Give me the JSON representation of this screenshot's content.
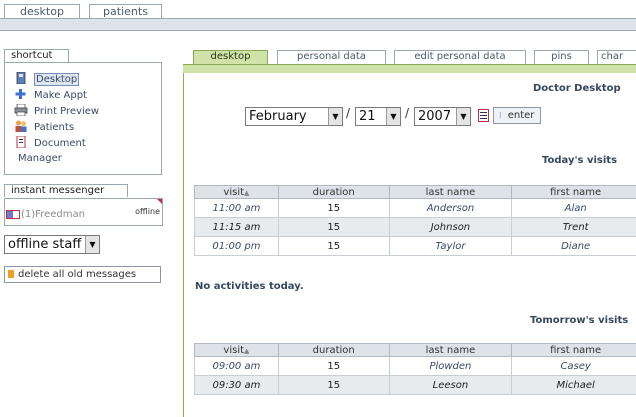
{
  "top_tabs": [
    "desktop",
    "patients"
  ],
  "shortcut": {
    "title": "shortcut",
    "items": [
      "Desktop",
      "Make Appt",
      "Print Preview",
      "Patients",
      "Document",
      "Manager"
    ]
  },
  "messenger": {
    "title": "instant messenger",
    "contact": "(1)Freedman",
    "status": "offline",
    "staff_select": "offline staff",
    "delete_label": "delete all old messages"
  },
  "content_tabs": [
    "desktop",
    "personal data",
    "edit personal data",
    "pins",
    "char"
  ],
  "page_title": "Doctor Desktop",
  "date": {
    "month": "February",
    "day": "21",
    "year": "2007",
    "enter_label": "enter"
  },
  "today": {
    "heading": "Today's visits",
    "headers": [
      "visit",
      "duration",
      "last name",
      "first name"
    ],
    "rows": [
      [
        "11:00 am",
        "15",
        "Anderson",
        "Alan"
      ],
      [
        "11:15 am",
        "15",
        "Johnson",
        "Trent"
      ],
      [
        "01:00 pm",
        "15",
        "Taylor",
        "Diane"
      ]
    ]
  },
  "no_activities": "No activities today.",
  "tomorrow": {
    "heading": "Tomorrow's visits",
    "headers": [
      "visit",
      "duration",
      "last name",
      "first name"
    ],
    "rows": [
      [
        "09:00 am",
        "15",
        "Plowden",
        "Casey"
      ],
      [
        "09:30 am",
        "15",
        "Leeson",
        "Michael"
      ]
    ]
  },
  "colors": {
    "accent_green": "#cfe2a8",
    "band_gray": "#dde3e9",
    "border": "#9aa8b4"
  }
}
